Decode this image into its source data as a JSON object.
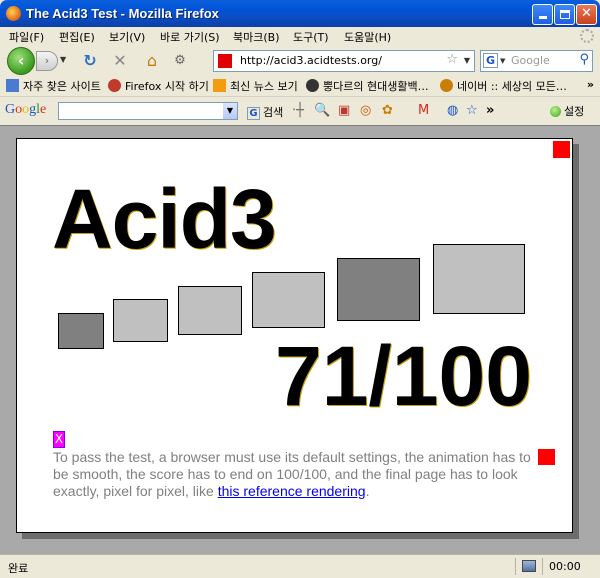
{
  "window": {
    "title": "The Acid3 Test - Mozilla Firefox"
  },
  "menu": [
    "파일(F)",
    "편집(E)",
    "보기(V)",
    "바로 가기(S)",
    "북마크(B)",
    "도구(T)",
    "도움말(H)"
  ],
  "nav": {
    "back_label": "‹",
    "forward_label": "›",
    "url": "http://acid3.acidtests.org/",
    "search_placeholder": "Google"
  },
  "bookmarks": [
    {
      "label": "자주 찾은 사이트",
      "icon": "folder-icon",
      "color": "#4a7bd3"
    },
    {
      "label": "Firefox 시작 하기",
      "icon": "firefox-icon",
      "color": "#c0392b"
    },
    {
      "label": "최신 뉴스 보기",
      "icon": "rss-icon",
      "color": "#f39c12"
    },
    {
      "label": "뿡다르의 현대생활백…",
      "icon": "chat-bubble-icon",
      "color": "#333333"
    },
    {
      "label": "네이버 :: 세상의 모든…",
      "icon": "naver-icon",
      "color": "#c87f0a"
    }
  ],
  "bookmarks_more": "»",
  "google_toolbar": {
    "logo_letters": [
      "G",
      "o",
      "o",
      "g",
      "l",
      "e"
    ],
    "logo_colors": [
      "#1b55c6",
      "#d62d20",
      "#f1b800",
      "#1b55c6",
      "#0a9e2f",
      "#d62d20"
    ],
    "search_label": "검색",
    "settings_label": "설정"
  },
  "acid": {
    "title": "Acid3",
    "score": "71/100",
    "marker": "X",
    "description": "To pass the test, a browser must use its default settings, the animation has to be smooth, the score has to end on 100/100, and the final page has to look exactly, pixel for pixel, like ",
    "link_text": "this reference rendering",
    "period": ".",
    "bucket_colors": [
      "#808080",
      "#c0c0c0",
      "#c0c0c0",
      "#c0c0c0",
      "#808080",
      "#c0c0c0"
    ]
  },
  "status": {
    "text": "완료",
    "clock": "00:00"
  }
}
